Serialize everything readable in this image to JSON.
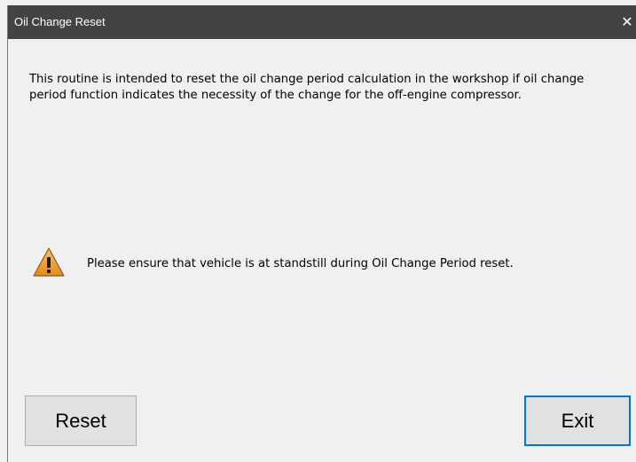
{
  "window": {
    "title": "Oil Change Reset",
    "close_symbol": "✕"
  },
  "content": {
    "description": "This routine is intended to reset the oil change period calculation in the workshop if oil change period function indicates the necessity of the change for the off-engine compressor.",
    "warning_icon": "warning-triangle-icon",
    "warning_text": "Please ensure that vehicle is at standstill during Oil Change Period reset."
  },
  "buttons": {
    "reset_label": "Reset",
    "exit_label": "Exit"
  },
  "colors": {
    "titlebar": "#434343",
    "background": "#f0f0f0",
    "button": "#e1e1e1",
    "focus_border": "#0078d7",
    "warning_fill": "#f0a030"
  }
}
